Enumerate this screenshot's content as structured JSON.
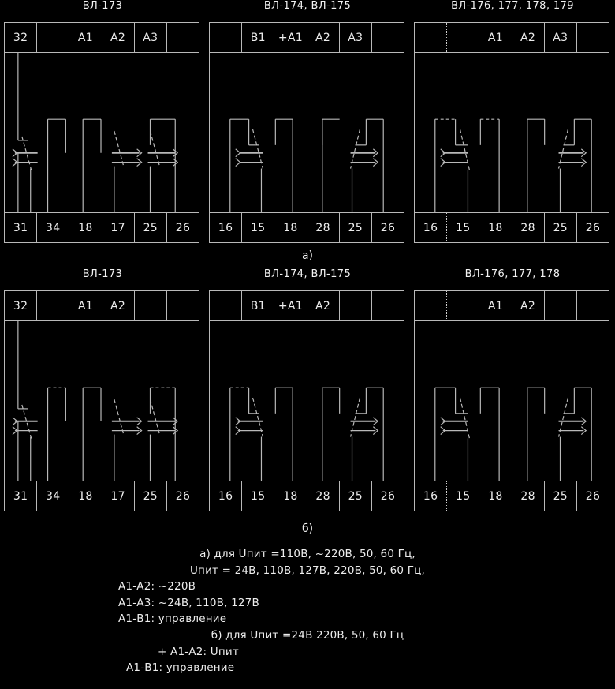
{
  "figure": {
    "title_row_a_caption": "а)",
    "title_row_b_caption": "б)"
  },
  "panels": [
    {
      "id": "a1",
      "title": "ВЛ-173",
      "top_terminals": [
        "32",
        "",
        "A1",
        "A2",
        "A3",
        ""
      ],
      "bottom_terminals": [
        "31",
        "34",
        "18",
        "17",
        "25",
        "26"
      ],
      "variant": "vl173"
    },
    {
      "id": "a2",
      "title": "ВЛ-174, ВЛ-175",
      "top_terminals": [
        "",
        "B1",
        "+A1",
        "A2",
        "A3",
        ""
      ],
      "bottom_terminals": [
        "16",
        "15",
        "18",
        "28",
        "25",
        "26"
      ],
      "variant": "vl174"
    },
    {
      "id": "a3",
      "title": "ВЛ-176, 177, 178, 179",
      "top_terminals": [
        "",
        "",
        "A1",
        "A2",
        "A3",
        ""
      ],
      "bottom_terminals": [
        "16",
        "15",
        "18",
        "28",
        "25",
        "26"
      ],
      "variant": "vl176"
    },
    {
      "id": "b1",
      "title": "ВЛ-173",
      "top_terminals": [
        "32",
        "",
        "A1",
        "A2",
        "",
        ""
      ],
      "bottom_terminals": [
        "31",
        "34",
        "18",
        "17",
        "25",
        "26"
      ],
      "variant": "vl173"
    },
    {
      "id": "b2",
      "title": "ВЛ-174, ВЛ-175",
      "top_terminals": [
        "",
        "B1",
        "+A1",
        "A2",
        "",
        ""
      ],
      "bottom_terminals": [
        "16",
        "15",
        "18",
        "28",
        "25",
        "26"
      ],
      "variant": "vl174"
    },
    {
      "id": "b3",
      "title": "ВЛ-176, 177, 178",
      "top_terminals": [
        "",
        "",
        "A1",
        "A2",
        "",
        ""
      ],
      "bottom_terminals": [
        "16",
        "15",
        "18",
        "28",
        "25",
        "26"
      ],
      "variant": "vl176"
    }
  ],
  "notes": {
    "line1": "а) для Uпит =110В, ~220В, 50, 60 Гц,",
    "line2": "Uпит = 24В, 110В, 127В, 220В, 50, 60 Гц,",
    "line3": "А1-А2: ~220В",
    "line4": "А1-А3: ~24В, 110В, 127В",
    "line5": "А1-В1: управление",
    "line6": "б) для Uпит =24В 220В, 50, 60 Гц",
    "line7": "+ А1-А2: Uпит",
    "line8": "А1-В1: управление"
  },
  "colors": {
    "background": "#000000",
    "line": "#b9b9b9",
    "text": "#ededed"
  }
}
